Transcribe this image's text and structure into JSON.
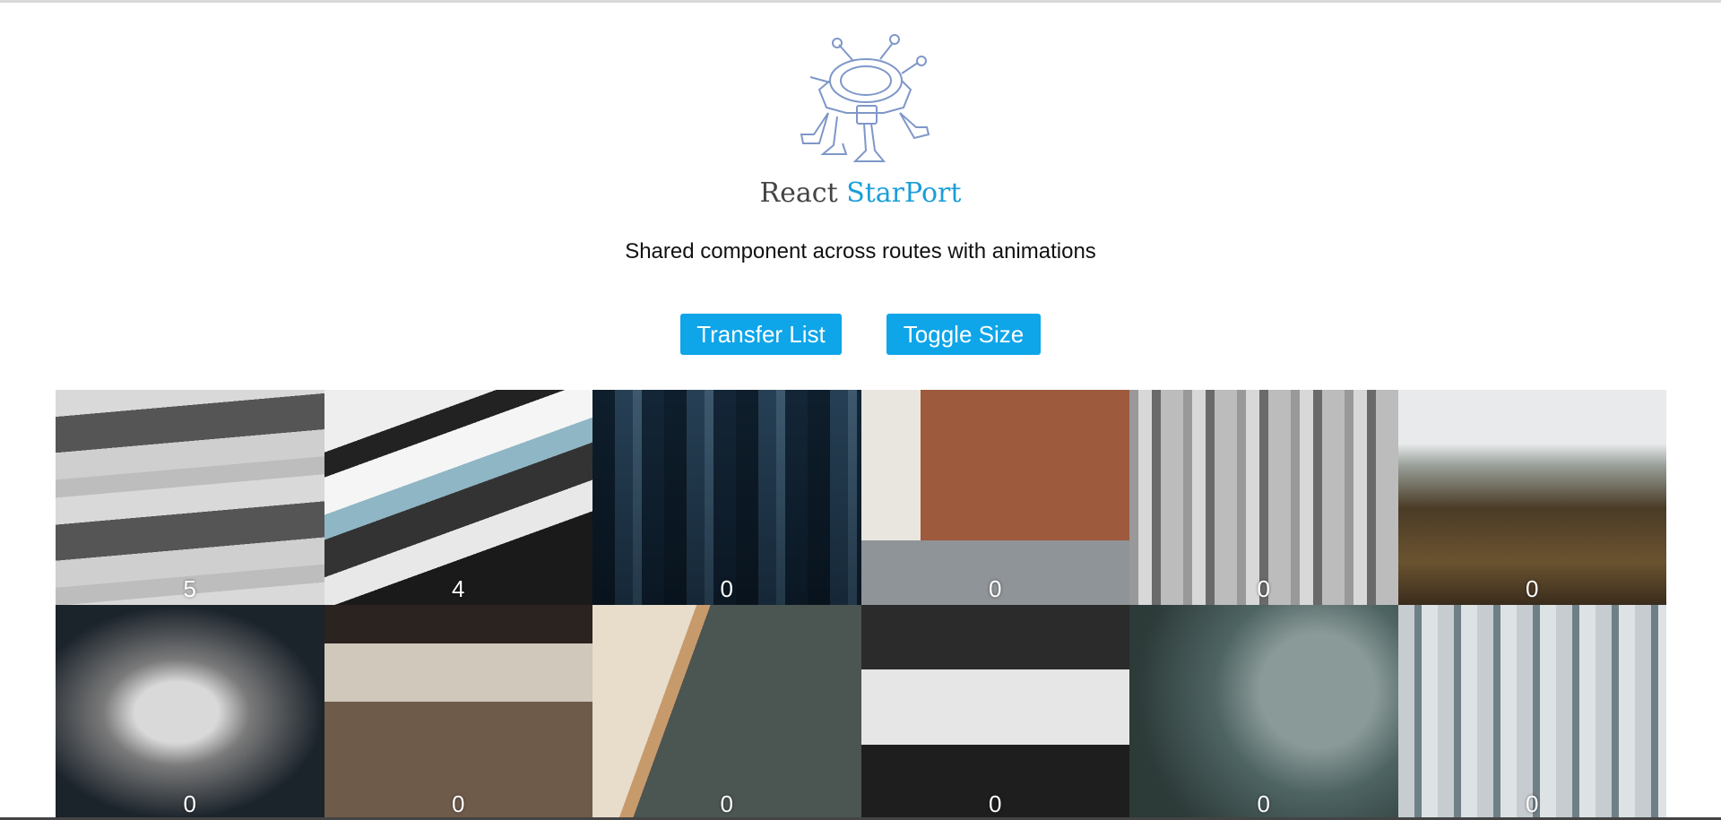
{
  "header": {
    "brand_primary": "React",
    "brand_accent": "StarPort",
    "subtitle": "Shared component across routes with animations"
  },
  "buttons": {
    "transfer_list": "Transfer List",
    "toggle_size": "Toggle Size"
  },
  "colors": {
    "accent": "#0ea5e9",
    "brand_accent": "#1a9ed9",
    "logo_stroke": "#7f97c9"
  },
  "grid": {
    "tiles": [
      {
        "count": "5"
      },
      {
        "count": "4"
      },
      {
        "count": "0"
      },
      {
        "count": "0"
      },
      {
        "count": "0"
      },
      {
        "count": "0"
      },
      {
        "count": "0"
      },
      {
        "count": "0"
      },
      {
        "count": "0"
      },
      {
        "count": "0"
      },
      {
        "count": "0"
      },
      {
        "count": "0"
      }
    ]
  }
}
